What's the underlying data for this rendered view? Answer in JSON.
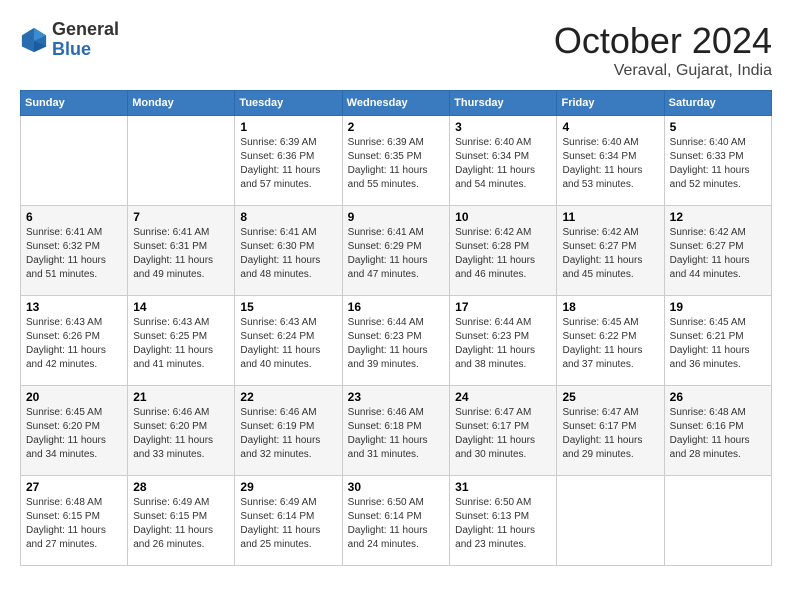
{
  "header": {
    "logo_line1": "General",
    "logo_line2": "Blue",
    "month_title": "October 2024",
    "location": "Veraval, Gujarat, India"
  },
  "weekdays": [
    "Sunday",
    "Monday",
    "Tuesday",
    "Wednesday",
    "Thursday",
    "Friday",
    "Saturday"
  ],
  "weeks": [
    [
      {
        "day": "",
        "sunrise": "",
        "sunset": "",
        "daylight": ""
      },
      {
        "day": "",
        "sunrise": "",
        "sunset": "",
        "daylight": ""
      },
      {
        "day": "1",
        "sunrise": "Sunrise: 6:39 AM",
        "sunset": "Sunset: 6:36 PM",
        "daylight": "Daylight: 11 hours and 57 minutes."
      },
      {
        "day": "2",
        "sunrise": "Sunrise: 6:39 AM",
        "sunset": "Sunset: 6:35 PM",
        "daylight": "Daylight: 11 hours and 55 minutes."
      },
      {
        "day": "3",
        "sunrise": "Sunrise: 6:40 AM",
        "sunset": "Sunset: 6:34 PM",
        "daylight": "Daylight: 11 hours and 54 minutes."
      },
      {
        "day": "4",
        "sunrise": "Sunrise: 6:40 AM",
        "sunset": "Sunset: 6:34 PM",
        "daylight": "Daylight: 11 hours and 53 minutes."
      },
      {
        "day": "5",
        "sunrise": "Sunrise: 6:40 AM",
        "sunset": "Sunset: 6:33 PM",
        "daylight": "Daylight: 11 hours and 52 minutes."
      }
    ],
    [
      {
        "day": "6",
        "sunrise": "Sunrise: 6:41 AM",
        "sunset": "Sunset: 6:32 PM",
        "daylight": "Daylight: 11 hours and 51 minutes."
      },
      {
        "day": "7",
        "sunrise": "Sunrise: 6:41 AM",
        "sunset": "Sunset: 6:31 PM",
        "daylight": "Daylight: 11 hours and 49 minutes."
      },
      {
        "day": "8",
        "sunrise": "Sunrise: 6:41 AM",
        "sunset": "Sunset: 6:30 PM",
        "daylight": "Daylight: 11 hours and 48 minutes."
      },
      {
        "day": "9",
        "sunrise": "Sunrise: 6:41 AM",
        "sunset": "Sunset: 6:29 PM",
        "daylight": "Daylight: 11 hours and 47 minutes."
      },
      {
        "day": "10",
        "sunrise": "Sunrise: 6:42 AM",
        "sunset": "Sunset: 6:28 PM",
        "daylight": "Daylight: 11 hours and 46 minutes."
      },
      {
        "day": "11",
        "sunrise": "Sunrise: 6:42 AM",
        "sunset": "Sunset: 6:27 PM",
        "daylight": "Daylight: 11 hours and 45 minutes."
      },
      {
        "day": "12",
        "sunrise": "Sunrise: 6:42 AM",
        "sunset": "Sunset: 6:27 PM",
        "daylight": "Daylight: 11 hours and 44 minutes."
      }
    ],
    [
      {
        "day": "13",
        "sunrise": "Sunrise: 6:43 AM",
        "sunset": "Sunset: 6:26 PM",
        "daylight": "Daylight: 11 hours and 42 minutes."
      },
      {
        "day": "14",
        "sunrise": "Sunrise: 6:43 AM",
        "sunset": "Sunset: 6:25 PM",
        "daylight": "Daylight: 11 hours and 41 minutes."
      },
      {
        "day": "15",
        "sunrise": "Sunrise: 6:43 AM",
        "sunset": "Sunset: 6:24 PM",
        "daylight": "Daylight: 11 hours and 40 minutes."
      },
      {
        "day": "16",
        "sunrise": "Sunrise: 6:44 AM",
        "sunset": "Sunset: 6:23 PM",
        "daylight": "Daylight: 11 hours and 39 minutes."
      },
      {
        "day": "17",
        "sunrise": "Sunrise: 6:44 AM",
        "sunset": "Sunset: 6:23 PM",
        "daylight": "Daylight: 11 hours and 38 minutes."
      },
      {
        "day": "18",
        "sunrise": "Sunrise: 6:45 AM",
        "sunset": "Sunset: 6:22 PM",
        "daylight": "Daylight: 11 hours and 37 minutes."
      },
      {
        "day": "19",
        "sunrise": "Sunrise: 6:45 AM",
        "sunset": "Sunset: 6:21 PM",
        "daylight": "Daylight: 11 hours and 36 minutes."
      }
    ],
    [
      {
        "day": "20",
        "sunrise": "Sunrise: 6:45 AM",
        "sunset": "Sunset: 6:20 PM",
        "daylight": "Daylight: 11 hours and 34 minutes."
      },
      {
        "day": "21",
        "sunrise": "Sunrise: 6:46 AM",
        "sunset": "Sunset: 6:20 PM",
        "daylight": "Daylight: 11 hours and 33 minutes."
      },
      {
        "day": "22",
        "sunrise": "Sunrise: 6:46 AM",
        "sunset": "Sunset: 6:19 PM",
        "daylight": "Daylight: 11 hours and 32 minutes."
      },
      {
        "day": "23",
        "sunrise": "Sunrise: 6:46 AM",
        "sunset": "Sunset: 6:18 PM",
        "daylight": "Daylight: 11 hours and 31 minutes."
      },
      {
        "day": "24",
        "sunrise": "Sunrise: 6:47 AM",
        "sunset": "Sunset: 6:17 PM",
        "daylight": "Daylight: 11 hours and 30 minutes."
      },
      {
        "day": "25",
        "sunrise": "Sunrise: 6:47 AM",
        "sunset": "Sunset: 6:17 PM",
        "daylight": "Daylight: 11 hours and 29 minutes."
      },
      {
        "day": "26",
        "sunrise": "Sunrise: 6:48 AM",
        "sunset": "Sunset: 6:16 PM",
        "daylight": "Daylight: 11 hours and 28 minutes."
      }
    ],
    [
      {
        "day": "27",
        "sunrise": "Sunrise: 6:48 AM",
        "sunset": "Sunset: 6:15 PM",
        "daylight": "Daylight: 11 hours and 27 minutes."
      },
      {
        "day": "28",
        "sunrise": "Sunrise: 6:49 AM",
        "sunset": "Sunset: 6:15 PM",
        "daylight": "Daylight: 11 hours and 26 minutes."
      },
      {
        "day": "29",
        "sunrise": "Sunrise: 6:49 AM",
        "sunset": "Sunset: 6:14 PM",
        "daylight": "Daylight: 11 hours and 25 minutes."
      },
      {
        "day": "30",
        "sunrise": "Sunrise: 6:50 AM",
        "sunset": "Sunset: 6:14 PM",
        "daylight": "Daylight: 11 hours and 24 minutes."
      },
      {
        "day": "31",
        "sunrise": "Sunrise: 6:50 AM",
        "sunset": "Sunset: 6:13 PM",
        "daylight": "Daylight: 11 hours and 23 minutes."
      },
      {
        "day": "",
        "sunrise": "",
        "sunset": "",
        "daylight": ""
      },
      {
        "day": "",
        "sunrise": "",
        "sunset": "",
        "daylight": ""
      }
    ]
  ]
}
